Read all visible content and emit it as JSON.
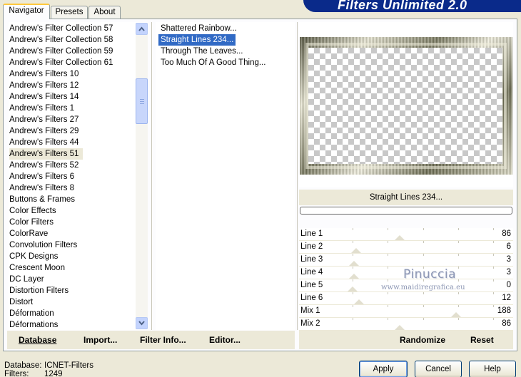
{
  "tabs": [
    {
      "label": "Navigator",
      "active": true
    },
    {
      "label": "Presets",
      "active": false
    },
    {
      "label": "About",
      "active": false
    }
  ],
  "banner": {
    "title": "Filters Unlimited 2.0",
    "color": "#0a2a8a"
  },
  "categories": {
    "items": [
      "Andrew's Filter Collection 57",
      "Andrew's Filter Collection 58",
      "Andrew's Filter Collection 59",
      "Andrew's Filter Collection 61",
      "Andrew's Filters 10",
      "Andrew's Filters 12",
      "Andrew's Filters 14",
      "Andrew's Filters 1",
      "Andrew's Filters 27",
      "Andrew's Filters 29",
      "Andrew's Filters 44",
      "Andrew's Filters 51",
      "Andrew's Filters 52",
      "Andrew's Filters 6",
      "Andrew's Filters 8",
      "Buttons & Frames",
      "Color Effects",
      "Color Filters",
      "ColorRave",
      "Convolution Filters",
      "CPK Designs",
      "Crescent Moon",
      "DC Layer",
      "Distortion Filters",
      "Distort",
      "Déformation",
      "Déformations"
    ],
    "selected": "Andrew's Filters 51"
  },
  "filters": {
    "items": [
      "Shattered Rainbow...",
      "Straight Lines 234...",
      "Through The Leaves...",
      "Too Much Of A Good Thing..."
    ],
    "selected": "Straight Lines 234..."
  },
  "preview": {
    "filter_name": "Straight Lines 234..."
  },
  "sliders": [
    {
      "label": "Line 1",
      "value": 86
    },
    {
      "label": "Line 2",
      "value": 6
    },
    {
      "label": "Line 3",
      "value": 3
    },
    {
      "label": "Line 4",
      "value": 3
    },
    {
      "label": "Line 5",
      "value": 0
    },
    {
      "label": "Line 6",
      "value": 12
    },
    {
      "label": "Mix 1",
      "value": 188
    },
    {
      "label": "Mix 2",
      "value": 86
    }
  ],
  "watermark": {
    "name": "Pinuccia",
    "url": "www.maidiregrafica.eu"
  },
  "commands": {
    "database": "Database",
    "import": "Import...",
    "filter_info": "Filter Info...",
    "editor": "Editor...",
    "randomize": "Randomize",
    "reset": "Reset"
  },
  "status": {
    "database_label": "Database:",
    "database_value": "ICNET-Filters",
    "filters_label": "Filters:",
    "filters_value": "1249"
  },
  "buttons": {
    "apply": "Apply",
    "cancel": "Cancel",
    "help": "Help"
  }
}
